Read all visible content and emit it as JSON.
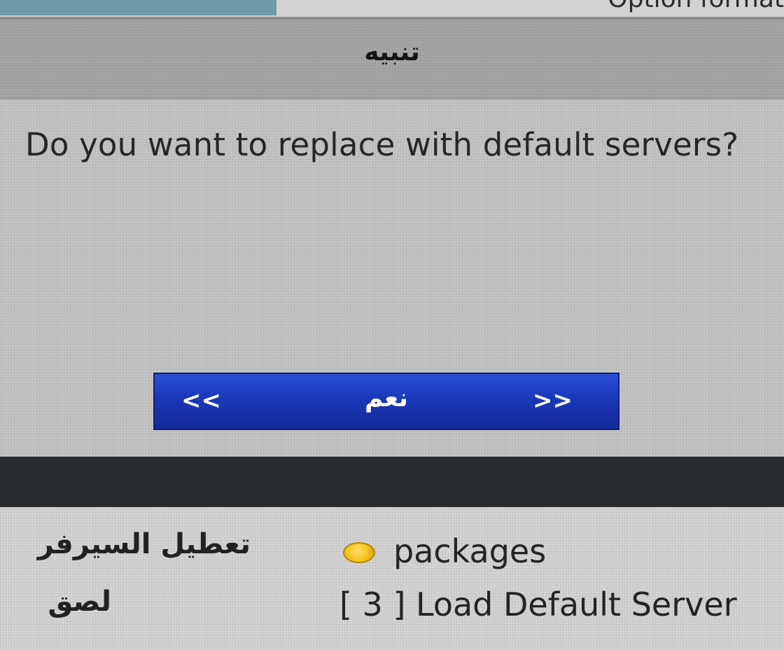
{
  "top_bar": {
    "cut_text": "Option format"
  },
  "dialog": {
    "title": "تنبيه",
    "message": "Do you want to replace with default servers?",
    "buttons": {
      "prev_arrow": "<<",
      "selected_label": "نعم",
      "next_arrow": ">>"
    }
  },
  "background_menu": {
    "items": [
      {
        "label_ar": "تعطيل السيرفر",
        "label_en": "packages",
        "indicator_color": "#f2c21a"
      },
      {
        "label_ar": "لصق",
        "label_en": "[ 3 ] Load Default Server"
      }
    ]
  }
}
